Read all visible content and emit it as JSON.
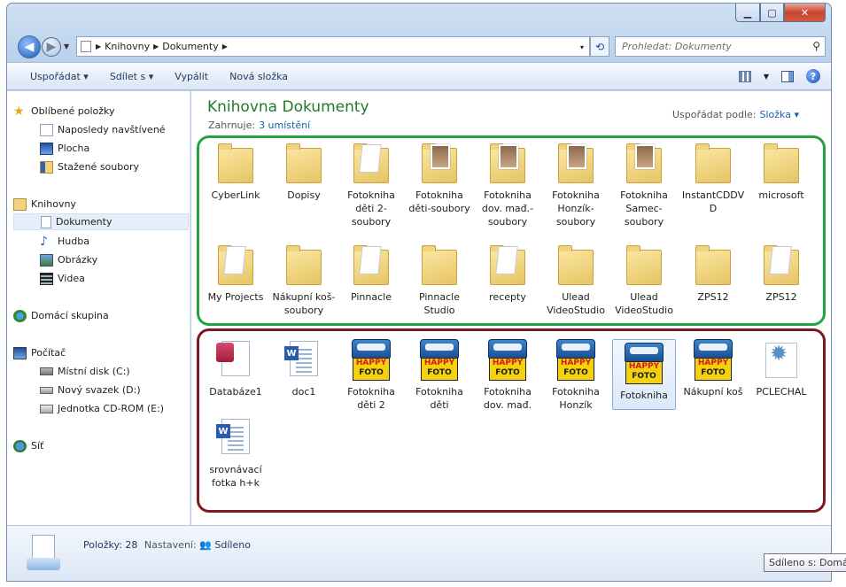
{
  "window": {
    "min": "▁",
    "max": "▢",
    "close": "✕"
  },
  "address": {
    "segments": [
      "Knihovny",
      "Dokumenty"
    ],
    "dropdown": "▾"
  },
  "search": {
    "placeholder": "Prohledat: Dokumenty"
  },
  "toolbar": {
    "organize": "Uspořádat ▾",
    "share": "Sdílet s ▾",
    "burn": "Vypálit",
    "new_folder": "Nová složka"
  },
  "sidebar": {
    "favorites": "Oblíbené položky",
    "fav_items": [
      "Naposledy navštívené",
      "Plocha",
      "Stažené soubory"
    ],
    "libraries": "Knihovny",
    "lib_items": [
      "Dokumenty",
      "Hudba",
      "Obrázky",
      "Videa"
    ],
    "homegroup": "Domácí skupina",
    "computer": "Počítač",
    "comp_items": [
      "Místní disk (C:)",
      "Nový svazek (D:)",
      "Jednotka CD-ROM (E:)"
    ],
    "network": "Síť"
  },
  "library": {
    "title": "Knihovna Dokumenty",
    "includes_label": "Zahrnuje:",
    "includes_link": "3 umístění",
    "sort_label": "Uspořádat podle:",
    "sort_value": "Složka ▾"
  },
  "folders": [
    {
      "name": "CyberLink",
      "style": "folder"
    },
    {
      "name": "Dopisy",
      "style": "folder"
    },
    {
      "name": "Fotokniha děti 2-soubory",
      "style": "paper"
    },
    {
      "name": "Fotokniha děti-soubory",
      "style": "photo"
    },
    {
      "name": "Fotokniha dov. mađ.-soubory",
      "style": "photo"
    },
    {
      "name": "Fotokniha Honzík-soubory",
      "style": "photo"
    },
    {
      "name": "Fotokniha Samec-soubory",
      "style": "photo"
    },
    {
      "name": "InstantCDDVD",
      "style": "folder"
    },
    {
      "name": "microsoft",
      "style": "folder"
    },
    {
      "name": "My Projects",
      "style": "paper"
    },
    {
      "name": "Nákupní koš-soubory",
      "style": "folder"
    },
    {
      "name": "Pinnacle",
      "style": "paper"
    },
    {
      "name": "Pinnacle Studio",
      "style": "folder"
    },
    {
      "name": "recepty",
      "style": "paper"
    },
    {
      "name": "Ulead VideoStudio",
      "style": "folder"
    },
    {
      "name": "Ulead VideoStudio",
      "style": "folder"
    },
    {
      "name": "ZPS12",
      "style": "folder"
    },
    {
      "name": "ZPS12",
      "style": "paper"
    }
  ],
  "files": [
    {
      "name": "Databáze1",
      "style": "access"
    },
    {
      "name": "doc1",
      "style": "word"
    },
    {
      "name": "Fotokniha děti 2",
      "style": "happy"
    },
    {
      "name": "Fotokniha děti",
      "style": "happy"
    },
    {
      "name": "Fotokniha dov. mađ.",
      "style": "happy"
    },
    {
      "name": "Fotokniha Honzík",
      "style": "happy"
    },
    {
      "name": "Fotokniha",
      "style": "happy",
      "selected": true
    },
    {
      "name": "Nákupní koš",
      "style": "happy"
    },
    {
      "name": "PCLECHAL",
      "style": "gear"
    },
    {
      "name": "srovnávací fotka h+k",
      "style": "word"
    }
  ],
  "happy_foto": {
    "top": "HAPPY",
    "bottom": "FOTO"
  },
  "status": {
    "items": "Položky: 28",
    "settings_label": "Nastavení:",
    "settings_value": "Sdíleno"
  },
  "tooltip": "Sdíleno s: Domácí skupina"
}
